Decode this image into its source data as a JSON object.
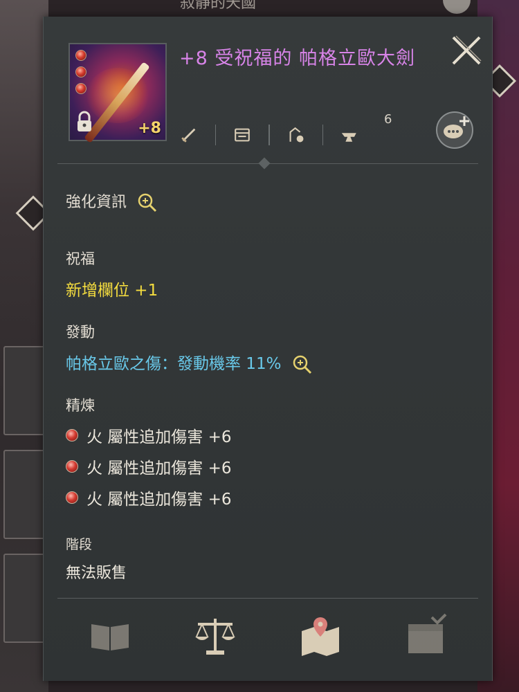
{
  "background": {
    "top_text": "寂靜的天國"
  },
  "item": {
    "title": "+8 受祝福的 帕格立歐大劍",
    "enhance_badge": "+8",
    "title_color": "#d884e8",
    "icon": "greatsword-icon",
    "locked": true,
    "gems": 3
  },
  "actions": {
    "items": [
      {
        "name": "sword-enhance-icon"
      },
      {
        "name": "storage-chest-icon"
      },
      {
        "name": "transfer-icon"
      },
      {
        "name": "anvil-icon"
      }
    ],
    "anvil_count": "6",
    "chat_button": "chat-plus-icon"
  },
  "sections": {
    "enhance": {
      "label": "強化資訊"
    },
    "blessing": {
      "label": "祝福",
      "value": "新增欄位 +1",
      "color": "#f5dd3f"
    },
    "activation": {
      "label": "發動",
      "value": "帕格立歐之傷：發動機率 11%",
      "color": "#69c9ea"
    },
    "refine": {
      "label": "精煉",
      "items": [
        "火 屬性追加傷害 +6",
        "火 屬性追加傷害 +6",
        "火 屬性追加傷害 +6"
      ]
    },
    "tier": {
      "label": "階段",
      "value": "無法販售"
    }
  },
  "bottom_icons": [
    "book-icon",
    "scale-icon",
    "map-pin-icon",
    "chest-check-icon"
  ]
}
